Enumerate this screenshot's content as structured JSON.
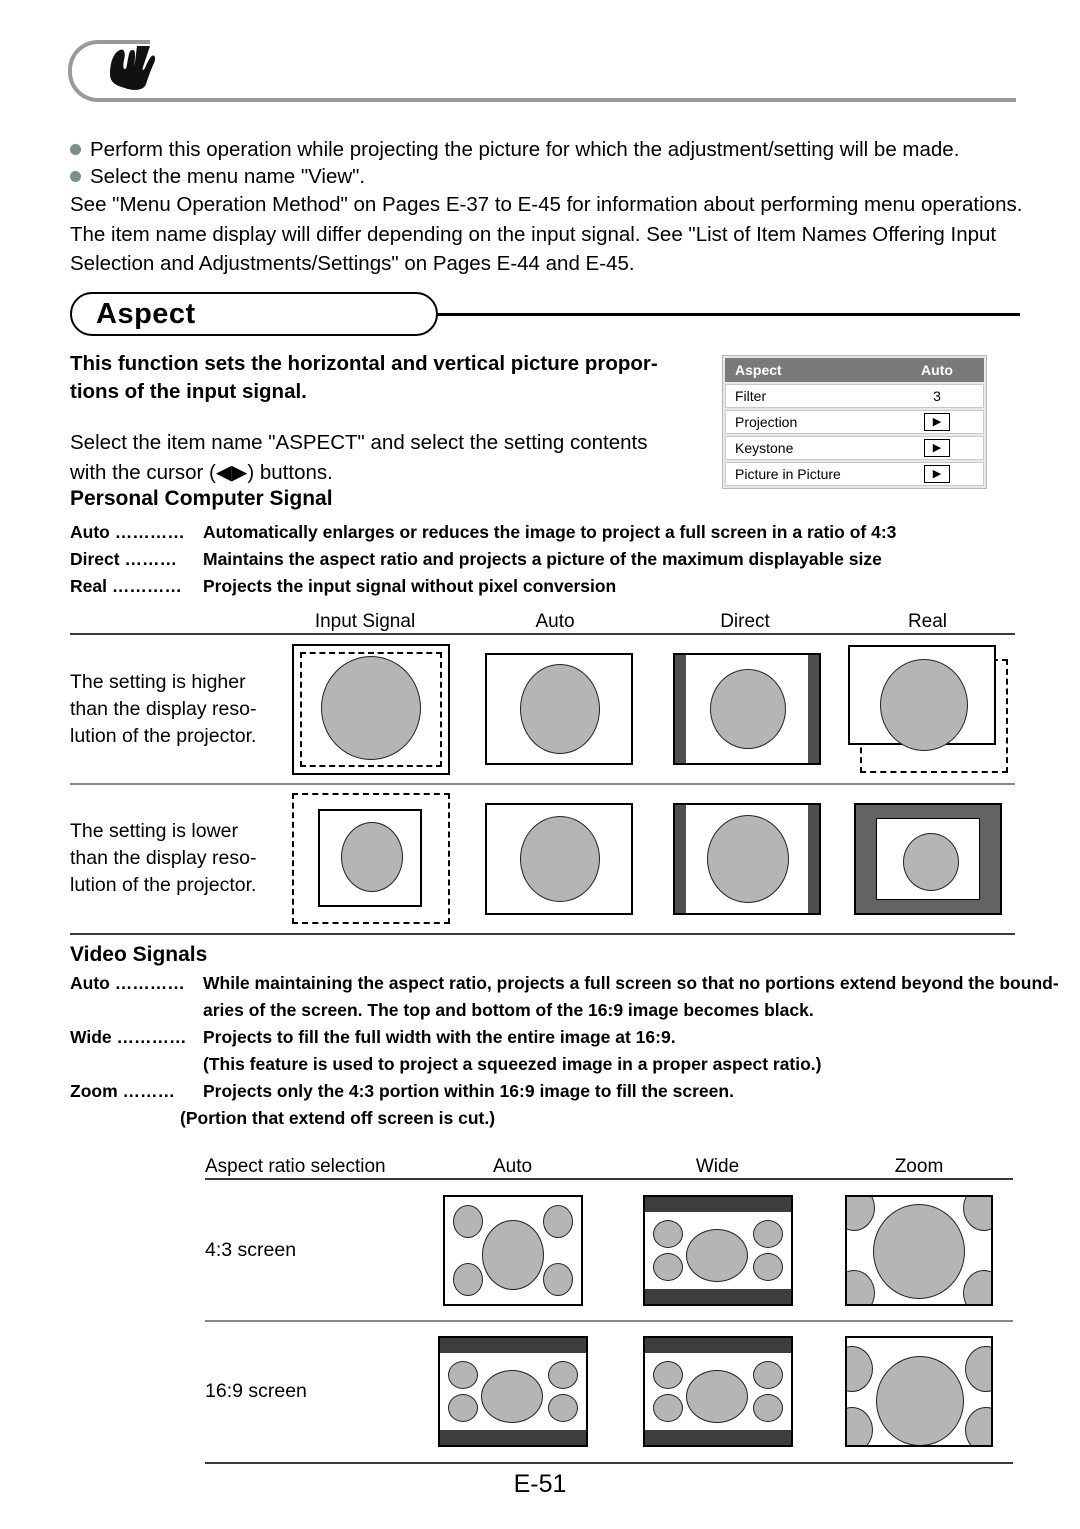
{
  "header": {
    "icon": "hand-pointing-icon"
  },
  "intro": {
    "bullets": [
      "Perform this operation while projecting the picture for which the adjustment/setting will be made.",
      "Select the menu name \"View\"."
    ],
    "paragraph_lines": [
      "See \"Menu Operation Method\" on Pages E-37 to E-45 for information about performing menu operations.",
      "The item name display will differ depending on the input signal. See \"List of Item Names Offering Input",
      "Selection and Adjustments/Settings\" on Pages E-44 and E-45."
    ]
  },
  "section": {
    "title": "Aspect"
  },
  "description": {
    "bold_lines": [
      "This function sets the horizontal and vertical picture propor-",
      "tions of the input signal."
    ],
    "normal_lines": [
      "Select the item name \"ASPECT\" and select the setting contents",
      "with the cursor (◀▶) buttons."
    ]
  },
  "osd_menu": {
    "rows": [
      {
        "label": "Aspect",
        "value": "Auto",
        "type": "header"
      },
      {
        "label": "Filter",
        "value": "3",
        "type": "value"
      },
      {
        "label": "Projection",
        "value": "▶",
        "type": "arrow"
      },
      {
        "label": "Keystone",
        "value": "▶",
        "type": "arrow"
      },
      {
        "label": "Picture in Picture",
        "value": "▶",
        "type": "arrow"
      }
    ]
  },
  "pc_signal": {
    "heading": "Personal Computer Signal",
    "definitions": [
      {
        "term": "Auto …………",
        "desc": "Automatically enlarges or reduces the image to project a full screen in a ratio of 4:3"
      },
      {
        "term": "Direct ………",
        "desc": "Maintains the aspect ratio and projects a picture of the maximum displayable size"
      },
      {
        "term": "Real …………",
        "desc": "Projects the input signal without pixel conversion"
      }
    ],
    "table": {
      "headers": [
        "Input Signal",
        "Auto",
        "Direct",
        "Real"
      ],
      "rows": [
        {
          "label_lines": [
            "The setting is higher",
            "than the display reso-",
            "lution of the projector."
          ]
        },
        {
          "label_lines": [
            "The setting is lower",
            "than the display reso-",
            "lution of the projector."
          ]
        }
      ]
    }
  },
  "video_signal": {
    "heading": "Video Signals",
    "definitions": [
      {
        "term": "Auto …………",
        "desc": "While maintaining the aspect ratio, projects a full screen so that no portions extend beyond the bound-",
        "cont": "aries of the screen. The top and bottom of the 16:9 image becomes black."
      },
      {
        "term": "Wide …………",
        "desc": "Projects to fill the full width with the entire image at 16:9.",
        "cont": "(This feature is used to project a squeezed image in a proper aspect ratio.)"
      },
      {
        "term": "Zoom ………",
        "desc": "Projects only the 4:3 portion within 16:9 image to fill the screen.",
        "cont": "(Portion that extend off screen is cut.)"
      }
    ],
    "table": {
      "headers": [
        "Aspect ratio selection",
        "Auto",
        "Wide",
        "Zoom"
      ],
      "rows": [
        {
          "label": "4:3 screen"
        },
        {
          "label": "16:9 screen"
        }
      ]
    }
  },
  "footer": {
    "page": "E-51"
  },
  "colors": {
    "osd_header_bg": "#7a7a7a",
    "ball_fill": "#b5b5b5",
    "dark_band": "#3d3d3d",
    "bullet": "#7b8f8b"
  }
}
